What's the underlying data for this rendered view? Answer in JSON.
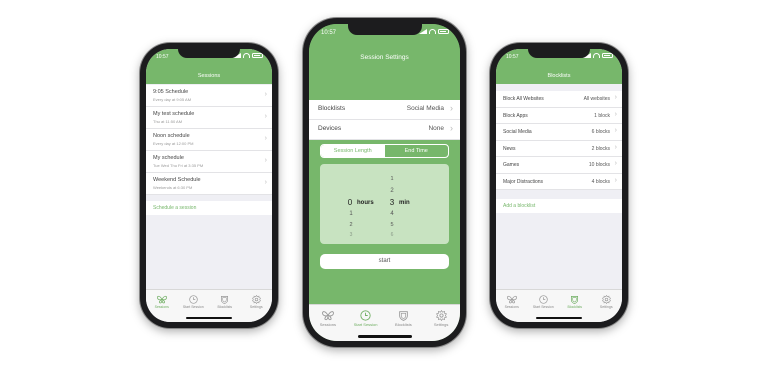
{
  "colors": {
    "brand_green": "#77b76b",
    "light_green": "#c8e3c1",
    "background": "#efeff4"
  },
  "left_phone": {
    "time": "10:57",
    "title": "Sessions",
    "schedules": [
      {
        "name": "9:05 Schedule",
        "detail": "Every day at 9:05 AM"
      },
      {
        "name": "My test schedule",
        "detail": "Thu at 11:50 AM"
      },
      {
        "name": "Noon schedule",
        "detail": "Every day at 12:00 PM"
      },
      {
        "name": "My schedule",
        "detail": "Tue Wed Thu Fri at 3:35 PM"
      },
      {
        "name": "Weekend Schedule",
        "detail": "Weekends at 6:30 PM"
      }
    ],
    "add_label": "Schedule a session",
    "tabs": [
      {
        "label": "Sessions",
        "icon": "butterfly-icon"
      },
      {
        "label": "Start Session",
        "icon": "clock-icon"
      },
      {
        "label": "Blocklists",
        "icon": "shield-icon"
      },
      {
        "label": "Settings",
        "icon": "gear-icon"
      }
    ]
  },
  "center_phone": {
    "time": "10:57",
    "title": "Session Settings",
    "rows": [
      {
        "label": "Blocklists",
        "value": "Social Media"
      },
      {
        "label": "Devices",
        "value": "None"
      }
    ],
    "segments": [
      "Session Length",
      "End Time"
    ],
    "picker": {
      "hours_above": [
        "",
        ""
      ],
      "hours_selected": "0",
      "hours_unit": "hours",
      "hours_below": [
        "1",
        "2",
        "3"
      ],
      "min_above": [
        "1",
        "2"
      ],
      "min_selected": "3",
      "min_unit": "min",
      "min_below": [
        "4",
        "5",
        "6"
      ]
    },
    "start_label": "start",
    "tabs": [
      {
        "label": "Sessions",
        "icon": "butterfly-icon"
      },
      {
        "label": "Start Session",
        "icon": "clock-icon"
      },
      {
        "label": "Blocklists",
        "icon": "shield-icon"
      },
      {
        "label": "Settings",
        "icon": "gear-icon"
      }
    ]
  },
  "right_phone": {
    "time": "10:57",
    "title": "Blocklists",
    "lists": [
      {
        "name": "Block All Websites",
        "count": "All websites"
      },
      {
        "name": "Block Apps",
        "count": "1 block"
      },
      {
        "name": "Social Media",
        "count": "6 blocks"
      },
      {
        "name": "News",
        "count": "2 blocks"
      },
      {
        "name": "Games",
        "count": "10 blocks"
      },
      {
        "name": "Major Distractions",
        "count": "4 blocks"
      }
    ],
    "add_label": "Add a blocklist",
    "tabs": [
      {
        "label": "Sessions",
        "icon": "butterfly-icon"
      },
      {
        "label": "Start Session",
        "icon": "clock-icon"
      },
      {
        "label": "Blocklists",
        "icon": "shield-icon"
      },
      {
        "label": "Settings",
        "icon": "gear-icon"
      }
    ]
  }
}
